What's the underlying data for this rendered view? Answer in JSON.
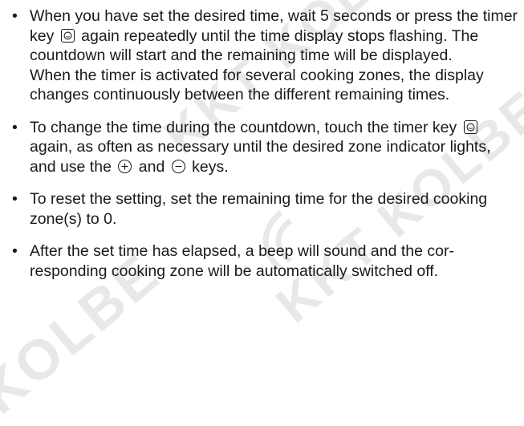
{
  "watermark": {
    "text": "KKT KOLBE",
    "text2": "KKT KOLBE",
    "text3": "KOLBE"
  },
  "bullets": [
    {
      "before_icon": "When you have set the desired time, wait 5 seconds or press the timer key ",
      "icon": "timer-key-icon",
      "after_icon": " again repeatedly until the time display stops flashing. The countdown will start and the remaining time will be displayed.",
      "second_paragraph": "When the timer is activated for several cooking zones, the display changes continuously between the different remaining times."
    },
    {
      "before_icon": "To change the time during the countdown, touch the timer key ",
      "icon": "timer-key-icon",
      "middle": " again, as often as necessary until the desired zone indicator lights, and use the ",
      "plus_icon": "plus-key-icon",
      "and_text": " and ",
      "minus_icon": "minus-key-icon",
      "after_icon": " keys."
    },
    {
      "text": "To reset the setting, set the remaining time for the desired cooking zone(s) to 0."
    },
    {
      "text": "After the set time has elapsed, a beep will sound and the cor-responding cooking zone will be automatically switched off."
    }
  ],
  "bullet_symbol": "•"
}
